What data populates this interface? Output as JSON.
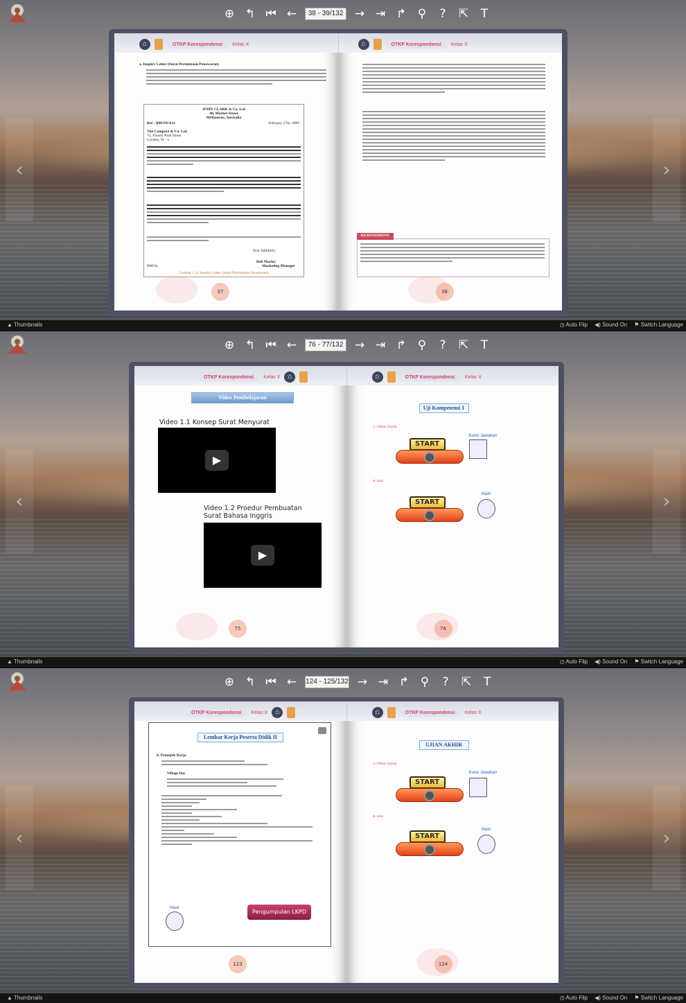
{
  "toolbar_icons": [
    "zoom-in-icon",
    "back-icon",
    "first-page-icon",
    "prev-page-icon",
    "next-page-icon",
    "last-page-icon",
    "forward-icon",
    "search-icon",
    "help-icon",
    "share-icon",
    "text-icon"
  ],
  "bottom": {
    "thumbnails": "Thumbnails",
    "auto_flip": "Auto Flip",
    "sound_on": "Sound On",
    "switch_language": "Switch Language"
  },
  "header": {
    "course": "OTKP Korespondensi",
    "class": "Kelas X"
  },
  "panels": [
    {
      "page_indicator": "38 - 39/132",
      "left_page_number": "37",
      "right_page_number": "38",
      "left_intro_heading": "a. Inquiry Letter (Surat Permintaan Penawaran)",
      "letter_company": "JOHN CLARK & Co. Ltd",
      "letter_street": "40, Market Street",
      "letter_city": "Melbourne, Australia",
      "letter_ref": "Ref   : BM/SN/A11",
      "letter_date": "February 17th, 2009",
      "recipient_line1": "The Compata & Co. Ltd",
      "recipient_line2": "72, Flower Park Street",
      "recipient_line3": "London, W - 1",
      "closing": "Your faithfully,",
      "signer_name": "Bob Marley",
      "signer_title": "Marketing Manager",
      "letter_initials": "BM/Sn",
      "caption": "Gambar 1.12 Inquiry Letter (Surat Permintaan Penawaran)",
      "kemandirian": "KEMANDIRIAN"
    },
    {
      "page_indicator": "76 - 77/132",
      "left_page_number": "75",
      "right_page_number": "76",
      "left_title": "Video Pembelajaran",
      "video1_label": "Video 1.1 Konsep Surat Menyurat",
      "video2_label": "Video 1.2 Proedur Pembuatan Surat Bahasa Inggris",
      "right_title": "Uji Kompetensi 1",
      "section_a": "A.  Pilihan Ganda",
      "section_b": "B.  Esai",
      "start_label": "START",
      "answer_key": "Kunci Jawaban",
      "hasil": "Hasil"
    },
    {
      "page_indicator": "124 - 125/132",
      "left_page_number": "123",
      "right_page_number": "124",
      "left_title": "Lembar Kerja Peserta Didik II",
      "lkpd_heading": "A. Petunjuk Kerja",
      "hotel_name": "Village Inn",
      "pengumpulan": "Pengumpulan LKPD",
      "hasil": "Hasil",
      "right_title": "UJIAN AKHIR",
      "section_a": "A.  Pilihan Ganda",
      "section_b": "B.  Esai",
      "start_label": "START",
      "answer_key": "Kunci Jawaban"
    }
  ]
}
